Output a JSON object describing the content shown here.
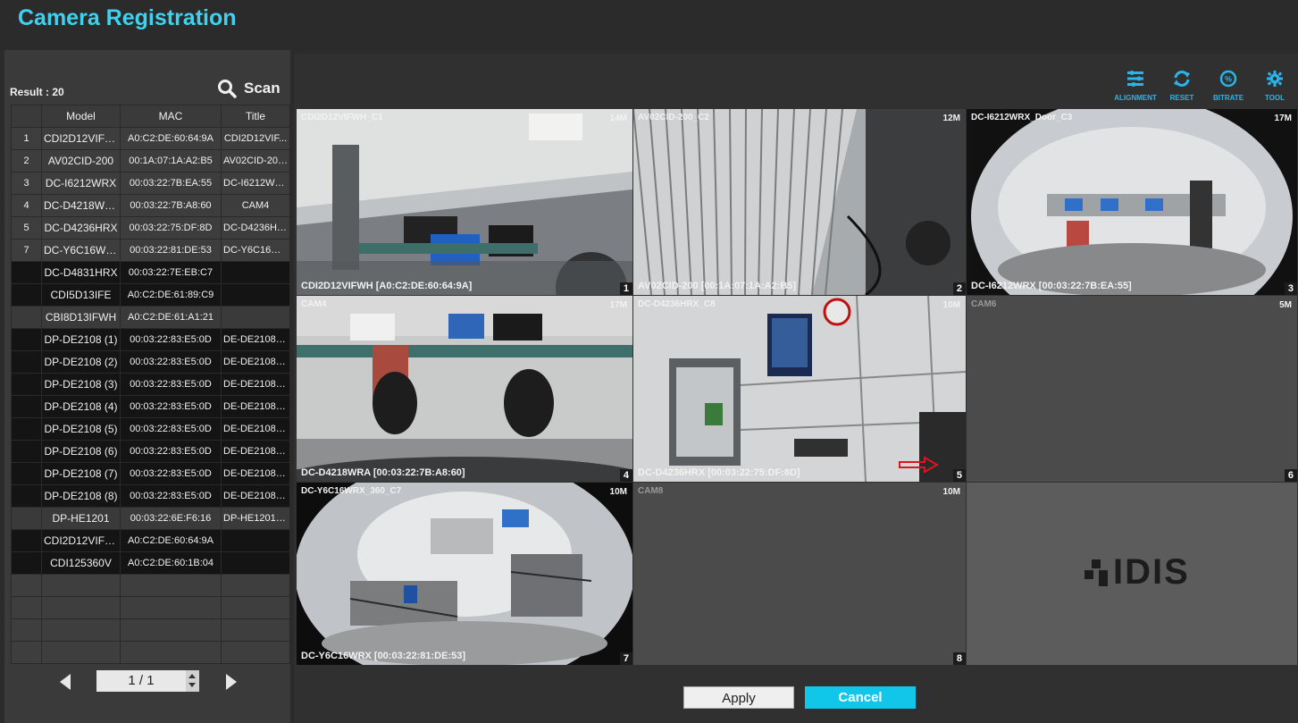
{
  "title": "Camera Registration",
  "left": {
    "result": "Result : 20",
    "scan_label": "Scan",
    "columns": [
      "Model",
      "MAC",
      "Title"
    ],
    "rows": [
      {
        "num": "1",
        "model": "CDI2D12VIFWH",
        "mac": "A0:C2:DE:60:64:9A",
        "title": "CDI2D12VIF...",
        "style": "reg"
      },
      {
        "num": "2",
        "model": "AV02CID-200",
        "mac": "00:1A:07:1A:A2:B5",
        "title": "AV02CID-200...",
        "style": "reg"
      },
      {
        "num": "3",
        "model": "DC-I6212WRX",
        "mac": "00:03:22:7B:EA:55",
        "title": "DC-I6212WR...",
        "style": "reg"
      },
      {
        "num": "4",
        "model": "DC-D4218WRA",
        "mac": "00:03:22:7B:A8:60",
        "title": "CAM4",
        "style": "reg"
      },
      {
        "num": "5",
        "model": "DC-D4236HRX",
        "mac": "00:03:22:75:DF:8D",
        "title": "DC-D4236HR...",
        "style": "reg"
      },
      {
        "num": "7",
        "model": "DC-Y6C16WRX",
        "mac": "00:03:22:81:DE:53",
        "title": "DC-Y6C16W...",
        "style": "reg"
      },
      {
        "num": "",
        "model": "DC-D4831HRX",
        "mac": "00:03:22:7E:EB:C7",
        "title": "",
        "style": "dark"
      },
      {
        "num": "",
        "model": "CDI5D13IFE",
        "mac": "A0:C2:DE:61:89:C9",
        "title": "",
        "style": "dark"
      },
      {
        "num": "",
        "model": "CBI8D13IFWH",
        "mac": "A0:C2:DE:61:A1:21",
        "title": "",
        "style": "mid"
      },
      {
        "num": "",
        "model": "DP-DE2108 (1)",
        "mac": "00:03:22:83:E5:0D",
        "title": "DE-DE2108 A...",
        "style": "dark"
      },
      {
        "num": "",
        "model": "DP-DE2108 (2)",
        "mac": "00:03:22:83:E5:0D",
        "title": "DE-DE2108 A...",
        "style": "dark"
      },
      {
        "num": "",
        "model": "DP-DE2108 (3)",
        "mac": "00:03:22:83:E5:0D",
        "title": "DE-DE2108 A...",
        "style": "dark"
      },
      {
        "num": "",
        "model": "DP-DE2108 (4)",
        "mac": "00:03:22:83:E5:0D",
        "title": "DE-DE2108 A...",
        "style": "dark"
      },
      {
        "num": "",
        "model": "DP-DE2108 (5)",
        "mac": "00:03:22:83:E5:0D",
        "title": "DE-DE2108 A...",
        "style": "dark"
      },
      {
        "num": "",
        "model": "DP-DE2108 (6)",
        "mac": "00:03:22:83:E5:0D",
        "title": "DE-DE2108 A...",
        "style": "dark"
      },
      {
        "num": "",
        "model": "DP-DE2108 (7)",
        "mac": "00:03:22:83:E5:0D",
        "title": "DE-DE2108 A...",
        "style": "dark"
      },
      {
        "num": "",
        "model": "DP-DE2108 (8)",
        "mac": "00:03:22:83:E5:0D",
        "title": "DE-DE2108 A...",
        "style": "dark"
      },
      {
        "num": "",
        "model": "DP-HE1201",
        "mac": "00:03:22:6E:F6:16",
        "title": "DP-HE1201_...",
        "style": "mid"
      },
      {
        "num": "",
        "model": "CDI2D12VIFWH",
        "mac": "A0:C2:DE:60:64:9A",
        "title": "",
        "style": "dark"
      },
      {
        "num": "",
        "model": "CDI125360V",
        "mac": "A0:C2:DE:60:1B:04",
        "title": "",
        "style": "dark"
      },
      {
        "num": "",
        "model": "",
        "mac": "",
        "title": "",
        "style": "empty"
      },
      {
        "num": "",
        "model": "",
        "mac": "",
        "title": "",
        "style": "empty"
      },
      {
        "num": "",
        "model": "",
        "mac": "",
        "title": "",
        "style": "empty"
      },
      {
        "num": "",
        "model": "",
        "mac": "",
        "title": "",
        "style": "empty"
      }
    ],
    "page": "1 / 1"
  },
  "tools": [
    {
      "label": "ALIGNMENT",
      "icon": "alignment-icon"
    },
    {
      "label": "RESET",
      "icon": "reset-icon"
    },
    {
      "label": "BITRATE",
      "icon": "bitrate-icon"
    },
    {
      "label": "TOOL",
      "icon": "gear-icon"
    }
  ],
  "cells": [
    {
      "title": "CDI2D12VIFWH_C1",
      "res": "14M",
      "info": "CDI2D12VIFWH [A0:C2:DE:60:64:9A]",
      "num": "1",
      "type": "camera"
    },
    {
      "title": "AV02CID-200_C2",
      "res": "12M",
      "info": "AV02CID-200 [00:1A:07:1A:A2:B5]",
      "num": "2",
      "type": "camera"
    },
    {
      "title": "DC-I6212WRX_Door_C3",
      "res": "17M",
      "info": "DC-I6212WRX [00:03:22:7B:EA:55]",
      "num": "3",
      "type": "camera"
    },
    {
      "title": "CAM4",
      "res": "17M",
      "info": "DC-D4218WRA [00:03:22:7B:A8:60]",
      "num": "4",
      "type": "camera"
    },
    {
      "title": "DC-D4236HRX_C8",
      "res": "10M",
      "info": "DC-D4236HRX [00:03:22:75:DF:8D]",
      "num": "5",
      "type": "camera",
      "selected": true
    },
    {
      "title": "CAM6",
      "res": "5M",
      "info": "",
      "num": "6",
      "type": "empty"
    },
    {
      "title": "DC-Y6C16WRX_360_C7",
      "res": "10M",
      "info": "DC-Y6C16WRX [00:03:22:81:DE:53]",
      "num": "7",
      "type": "camera"
    },
    {
      "title": "CAM8",
      "res": "10M",
      "info": "",
      "num": "8",
      "type": "empty"
    },
    {
      "title": "",
      "res": "",
      "info": "",
      "num": "",
      "type": "logo"
    }
  ],
  "logo_text": "IDIS",
  "buttons": {
    "apply": "Apply",
    "cancel": "Cancel"
  },
  "colors": {
    "accent": "#12c6ea",
    "title": "#3fd2f0",
    "selected": "#e0141e"
  }
}
